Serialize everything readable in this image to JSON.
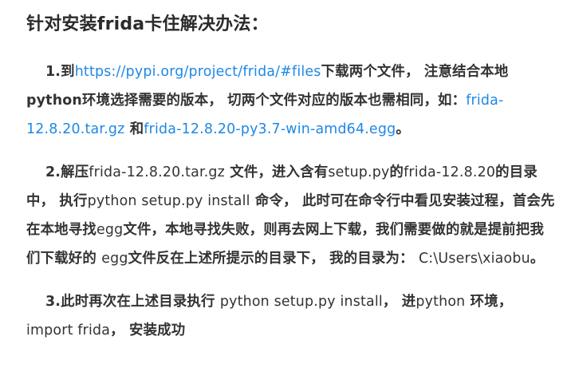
{
  "title": "针对安装frida卡住解决办法：",
  "step1": {
    "prefix": "1.到",
    "link_url": "https://pypi.org/project/frida/#files",
    "text_a": "下载两个文件， 注意结合本地",
    "line2": "python环境选择需要的版本， 切两个文件对应的版本也需相同，如：",
    "file1": "frida-12.8.20.tar.gz",
    "and": " 和",
    "file2": "frida-12.8.20-py3.7-win-amd64.egg",
    "end": "。"
  },
  "step2": {
    "prefix": "2.解压",
    "file": "frida-12.8.20.tar.gz",
    "text_a": " 文件，进入含有",
    "setup": "setup.py",
    "text_b": "的",
    "folder": "frida-12.8.20",
    "text_c": "的目录中， 执行",
    "command": "python setup.py install",
    "text_d": " 命令， 此时可在命令行中看见安装过程，首会先在本地寻找",
    "egg1": "egg",
    "text_e": "文件，本地寻找失败，则再去网上下载，我们需要做的就是提前把我们下载好的 ",
    "egg2": "egg",
    "text_f": "文件反在上述所提示的目录下， 我的目录为： ",
    "path": "C:\\Users\\xiaobu",
    "end": "。"
  },
  "step3": {
    "prefix": "3.此时再次在上述目录执行 ",
    "command": "python setup.py install",
    "text_a": "， 进",
    "python": "python",
    "text_b": " 环境，",
    "import": "import frida",
    "text_c": "， 安装成功"
  }
}
